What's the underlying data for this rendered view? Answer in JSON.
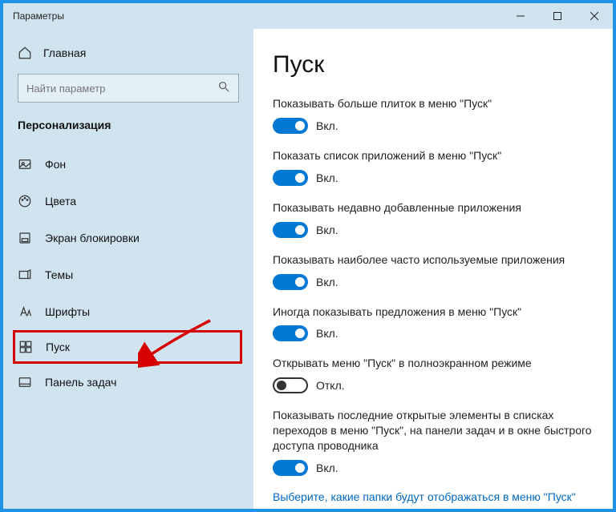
{
  "titlebar": {
    "title": "Параметры"
  },
  "sidebar": {
    "home": "Главная",
    "search_placeholder": "Найти параметр",
    "section": "Персонализация",
    "items": [
      {
        "label": "Фон"
      },
      {
        "label": "Цвета"
      },
      {
        "label": "Экран блокировки"
      },
      {
        "label": "Темы"
      },
      {
        "label": "Шрифты"
      },
      {
        "label": "Пуск"
      },
      {
        "label": "Панель задач"
      }
    ]
  },
  "page": {
    "title": "Пуск",
    "settings": [
      {
        "label": "Показывать больше плиток в меню \"Пуск\"",
        "on": true,
        "state": "Вкл."
      },
      {
        "label": "Показать список приложений в меню \"Пуск\"",
        "on": true,
        "state": "Вкл."
      },
      {
        "label": "Показывать недавно добавленные приложения",
        "on": true,
        "state": "Вкл."
      },
      {
        "label": "Показывать наиболее часто используемые приложения",
        "on": true,
        "state": "Вкл."
      },
      {
        "label": "Иногда показывать предложения в меню \"Пуск\"",
        "on": true,
        "state": "Вкл."
      },
      {
        "label": "Открывать меню \"Пуск\" в полноэкранном режиме",
        "on": false,
        "state": "Откл."
      },
      {
        "label": "Показывать последние открытые элементы в списках переходов в меню \"Пуск\", на панели задач и в окне быстрого доступа проводника",
        "on": true,
        "state": "Вкл."
      }
    ],
    "link": "Выберите, какие папки будут отображаться в меню \"Пуск\""
  }
}
